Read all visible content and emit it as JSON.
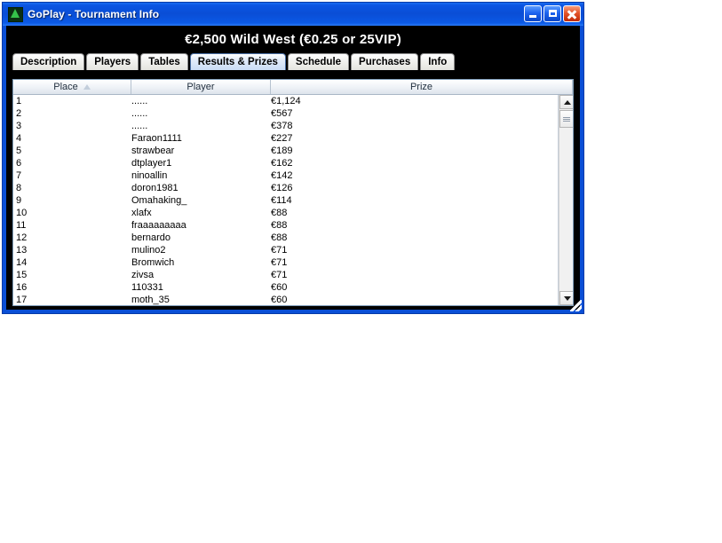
{
  "window": {
    "title": "GoPlay - Tournament Info",
    "icon": "tree-icon",
    "controls": {
      "minimize": "minimize-button",
      "maximize": "maximize-button",
      "close": "close-button"
    }
  },
  "banner": {
    "title": "€2,500 Wild West (€0.25 or 25VIP)"
  },
  "tabs": [
    {
      "label": "Description",
      "selected": false
    },
    {
      "label": "Players",
      "selected": false
    },
    {
      "label": "Tables",
      "selected": false
    },
    {
      "label": "Results & Prizes",
      "selected": true
    },
    {
      "label": "Schedule",
      "selected": false
    },
    {
      "label": "Purchases",
      "selected": false
    },
    {
      "label": "Info",
      "selected": false
    }
  ],
  "table": {
    "columns": [
      {
        "label": "Place",
        "sort": "ascending"
      },
      {
        "label": "Player",
        "sort": null
      },
      {
        "label": "Prize",
        "sort": null
      }
    ],
    "rows": [
      {
        "place": "1",
        "player": "......",
        "prize": "€1,124"
      },
      {
        "place": "2",
        "player": "......",
        "prize": "€567"
      },
      {
        "place": "3",
        "player": "......",
        "prize": "€378"
      },
      {
        "place": "4",
        "player": "Faraon1111",
        "prize": "€227"
      },
      {
        "place": "5",
        "player": "strawbear",
        "prize": "€189"
      },
      {
        "place": "6",
        "player": "dtplayer1",
        "prize": "€162"
      },
      {
        "place": "7",
        "player": "ninoallin",
        "prize": "€142"
      },
      {
        "place": "8",
        "player": "doron1981",
        "prize": "€126"
      },
      {
        "place": "9",
        "player": "Omahaking_",
        "prize": "€114"
      },
      {
        "place": "10",
        "player": "xlafx",
        "prize": "€88"
      },
      {
        "place": "11",
        "player": "fraaaaaaaaa",
        "prize": "€88"
      },
      {
        "place": "12",
        "player": "bernardo",
        "prize": "€88"
      },
      {
        "place": "13",
        "player": "mulino2",
        "prize": "€71"
      },
      {
        "place": "14",
        "player": "Bromwich",
        "prize": "€71"
      },
      {
        "place": "15",
        "player": "zivsa",
        "prize": "€71"
      },
      {
        "place": "16",
        "player": "110331",
        "prize": "€60"
      },
      {
        "place": "17",
        "player": "moth_35",
        "prize": "€60"
      }
    ]
  },
  "scrollbar": {
    "up": "scroll-up-arrow",
    "down": "scroll-down-arrow",
    "thumb": "scroll-thumb"
  },
  "colors": {
    "titlebar": "#0a4ed6",
    "banner_bg": "#000000",
    "selected_tab": "#c9dcf5"
  }
}
